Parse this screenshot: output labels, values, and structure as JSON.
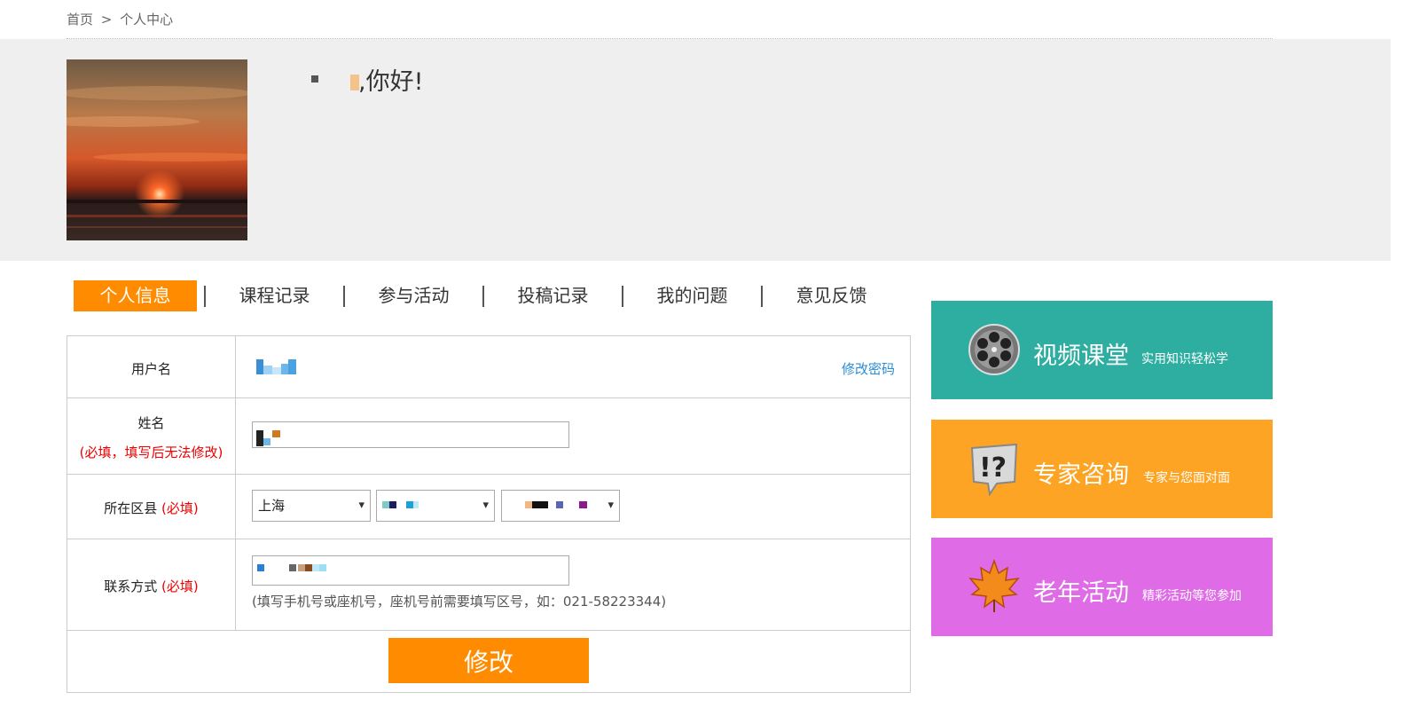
{
  "breadcrumb": {
    "home": "首页",
    "sep": ">",
    "current": "个人中心"
  },
  "greeting": {
    "text": ",你好!"
  },
  "tabs": [
    "个人信息",
    "课程记录",
    "参与活动",
    "投稿记录",
    "我的问题",
    "意见反馈"
  ],
  "form": {
    "username_label": "用户名",
    "change_password": "修改密码",
    "name_label": "姓名",
    "name_required": "(必填，填写后无法修改)",
    "district_label": "所在区县",
    "district_required": "(必填)",
    "province_value": "上海",
    "contact_label": "联系方式",
    "contact_required": "(必填)",
    "contact_hint": "(填写手机号或座机号，座机号前需要填写区号，如：021-58223344)",
    "submit": "修改"
  },
  "promos": [
    {
      "title": "视频课堂",
      "subtitle": "实用知识轻松学",
      "color": "#2eaea1",
      "icon": "film-reel-icon"
    },
    {
      "title": "专家咨询",
      "subtitle": "专家与您面对面",
      "color": "#fda424",
      "icon": "question-bubble-icon"
    },
    {
      "title": "老年活动",
      "subtitle": "精彩活动等您参加",
      "color": "#df6ce6",
      "icon": "maple-leaf-icon"
    }
  ],
  "colors": {
    "accent": "#ff8c00",
    "link": "#2a8dd4",
    "required": "#e00000"
  }
}
